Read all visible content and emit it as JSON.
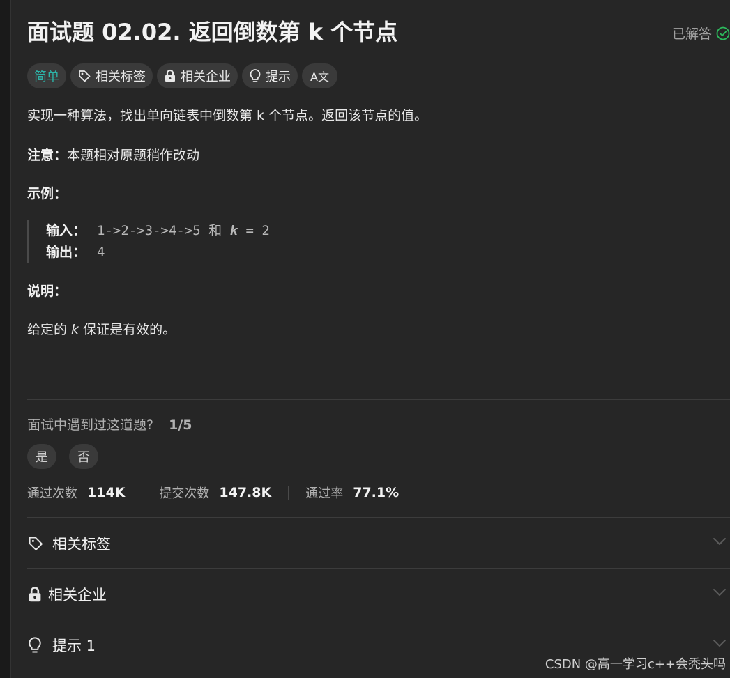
{
  "problem": {
    "title": "面试题 02.02. 返回倒数第 k 个节点",
    "status": "已解答"
  },
  "tags": {
    "difficulty": "简单",
    "related_tags": "相关标签",
    "related_companies": "相关企业",
    "hint": "提示",
    "translate": "A文"
  },
  "description": {
    "intro": "实现一种算法，找出单向链表中倒数第 k 个节点。返回该节点的值。",
    "note_label": "注意：",
    "note_text": "本题相对原题稍作改动",
    "example_label": "示例：",
    "example": {
      "input_label": "输入：",
      "input_value_pre": "1->2->3->4->5 和 ",
      "input_k": "k",
      "input_value_post": " = 2",
      "output_label": "输出：",
      "output_value": "4"
    },
    "explain_label": "说明：",
    "explain_pre": "给定的 ",
    "explain_k": "k",
    "explain_post": " 保证是有效的。"
  },
  "interview": {
    "question": "面试中遇到过这道题?",
    "ratio": "1/5",
    "yes": "是",
    "no": "否"
  },
  "stats": {
    "accepted_label": "通过次数",
    "accepted_value": "114K",
    "submissions_label": "提交次数",
    "submissions_value": "147.8K",
    "rate_label": "通过率",
    "rate_value": "77.1%"
  },
  "accordion": {
    "tags": "相关标签",
    "companies": "相关企业",
    "hint": "提示 1"
  },
  "watermark": "CSDN @高一学习c++会秃头吗",
  "colors": {
    "background": "#262626",
    "easy": "#2db3a8",
    "solved_check": "#2cbb5d"
  }
}
